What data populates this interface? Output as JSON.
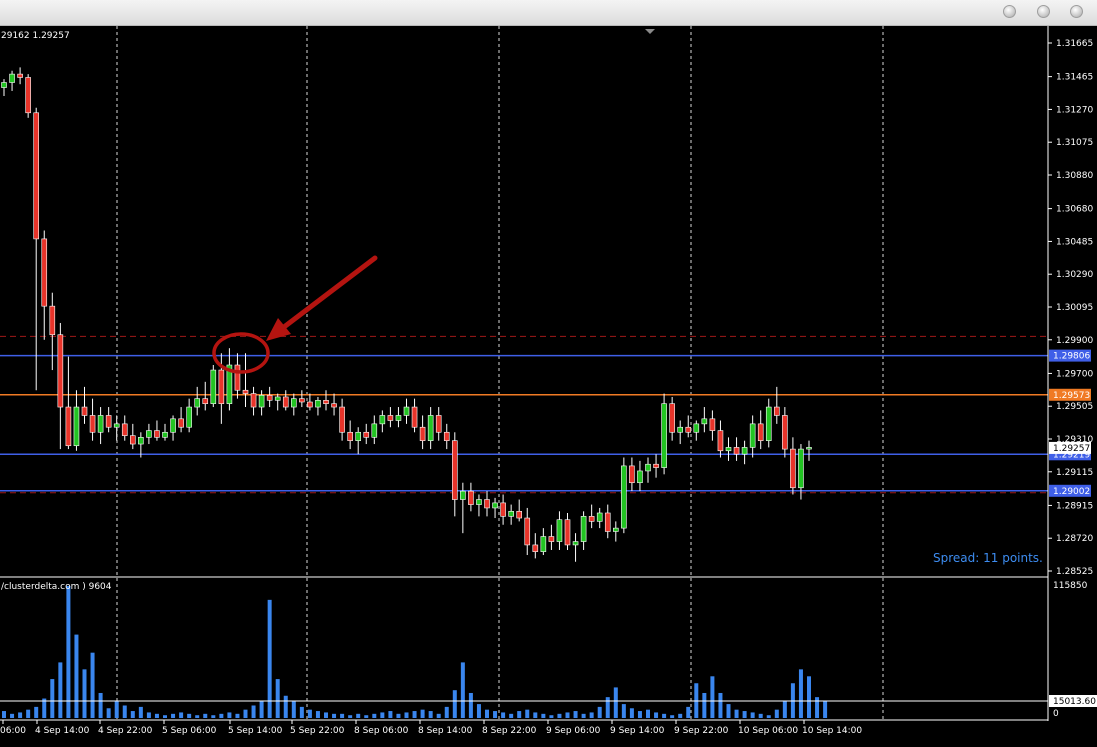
{
  "window": {
    "buttons": [
      "minimize-button",
      "maximize-button",
      "close-button"
    ]
  },
  "header": {
    "ohlc_text": "29162 1.29257"
  },
  "price_axis": {
    "labels": [
      "1.31665",
      "1.31465",
      "1.31270",
      "1.31075",
      "1.30880",
      "1.30680",
      "1.30485",
      "1.30290",
      "1.30095",
      "1.29900",
      "1.29700",
      "1.29505",
      "1.29310",
      "1.29115",
      "1.28915",
      "1.28720",
      "1.28525"
    ]
  },
  "levels": {
    "blue_upper": "1.29806",
    "orange": "1.29573",
    "current_price": "1.29257",
    "blue_mid": "1.29219",
    "blue_lower": "1.29002"
  },
  "spread_text": "Spread: 11 points.",
  "indicator": {
    "label": "/clusterdelta.com ) 9604",
    "axis_top": "115850",
    "axis_level": "15013.60",
    "axis_zero": "0"
  },
  "time_axis": {
    "labels": [
      "06:00",
      "4 Sep 14:00",
      "4 Sep 22:00",
      "5 Sep 06:00",
      "5 Sep 14:00",
      "5 Sep 22:00",
      "8 Sep 06:00",
      "8 Sep 14:00",
      "8 Sep 22:00",
      "9 Sep 06:00",
      "9 Sep 14:00",
      "9 Sep 22:00",
      "10 Sep 06:00",
      "10 Sep 14:00"
    ]
  },
  "colors": {
    "background": "#000000",
    "bull": "#22c422",
    "bear": "#e8342a",
    "support_line": "#3f5fe8",
    "orange_line": "#f07a24",
    "dashed_red": "#a01818",
    "volume": "#3a86ee",
    "annotation": "#b41410",
    "grid": "#ffffff"
  },
  "candles": [
    {
      "o": 1.314,
      "h": 1.3145,
      "l": 1.3135,
      "c": 1.3143
    },
    {
      "o": 1.3143,
      "h": 1.315,
      "l": 1.3138,
      "c": 1.3148
    },
    {
      "o": 1.3148,
      "h": 1.3152,
      "l": 1.3142,
      "c": 1.3146
    },
    {
      "o": 1.3146,
      "h": 1.3148,
      "l": 1.3122,
      "c": 1.3125
    },
    {
      "o": 1.3125,
      "h": 1.3128,
      "l": 1.296,
      "c": 1.305
    },
    {
      "o": 1.305,
      "h": 1.3055,
      "l": 1.299,
      "c": 1.301
    },
    {
      "o": 1.301,
      "h": 1.3018,
      "l": 1.2972,
      "c": 1.2993
    },
    {
      "o": 1.2993,
      "h": 1.3,
      "l": 1.2925,
      "c": 1.295
    },
    {
      "o": 1.295,
      "h": 1.298,
      "l": 1.2925,
      "c": 1.2927
    },
    {
      "o": 1.2927,
      "h": 1.296,
      "l": 1.2924,
      "c": 1.295
    },
    {
      "o": 1.295,
      "h": 1.2962,
      "l": 1.294,
      "c": 1.2945
    },
    {
      "o": 1.2945,
      "h": 1.2955,
      "l": 1.293,
      "c": 1.2935
    },
    {
      "o": 1.2935,
      "h": 1.295,
      "l": 1.2928,
      "c": 1.2945
    },
    {
      "o": 1.2945,
      "h": 1.295,
      "l": 1.2935,
      "c": 1.2938
    },
    {
      "o": 1.2938,
      "h": 1.2945,
      "l": 1.293,
      "c": 1.294
    },
    {
      "o": 1.294,
      "h": 1.2945,
      "l": 1.293,
      "c": 1.2933
    },
    {
      "o": 1.2933,
      "h": 1.294,
      "l": 1.2925,
      "c": 1.2928
    },
    {
      "o": 1.2928,
      "h": 1.2935,
      "l": 1.292,
      "c": 1.2932
    },
    {
      "o": 1.2932,
      "h": 1.294,
      "l": 1.2928,
      "c": 1.2936
    },
    {
      "o": 1.2936,
      "h": 1.2942,
      "l": 1.293,
      "c": 1.2932
    },
    {
      "o": 1.2932,
      "h": 1.294,
      "l": 1.293,
      "c": 1.2935
    },
    {
      "o": 1.2935,
      "h": 1.2945,
      "l": 1.293,
      "c": 1.2943
    },
    {
      "o": 1.2943,
      "h": 1.295,
      "l": 1.2935,
      "c": 1.2938
    },
    {
      "o": 1.2938,
      "h": 1.2955,
      "l": 1.2935,
      "c": 1.295
    },
    {
      "o": 1.295,
      "h": 1.2962,
      "l": 1.2945,
      "c": 1.2955
    },
    {
      "o": 1.2955,
      "h": 1.2965,
      "l": 1.2948,
      "c": 1.2952
    },
    {
      "o": 1.2952,
      "h": 1.2975,
      "l": 1.295,
      "c": 1.2972
    },
    {
      "o": 1.2972,
      "h": 1.2982,
      "l": 1.294,
      "c": 1.2952
    },
    {
      "o": 1.2952,
      "h": 1.2985,
      "l": 1.2948,
      "c": 1.2975
    },
    {
      "o": 1.2975,
      "h": 1.2982,
      "l": 1.2955,
      "c": 1.296
    },
    {
      "o": 1.296,
      "h": 1.2982,
      "l": 1.295,
      "c": 1.2958
    },
    {
      "o": 1.2958,
      "h": 1.2962,
      "l": 1.2945,
      "c": 1.295
    },
    {
      "o": 1.295,
      "h": 1.296,
      "l": 1.2945,
      "c": 1.2957
    },
    {
      "o": 1.2957,
      "h": 1.2962,
      "l": 1.295,
      "c": 1.2954
    },
    {
      "o": 1.2954,
      "h": 1.2958,
      "l": 1.2948,
      "c": 1.2956
    },
    {
      "o": 1.2956,
      "h": 1.296,
      "l": 1.2948,
      "c": 1.295
    },
    {
      "o": 1.295,
      "h": 1.2958,
      "l": 1.2945,
      "c": 1.2955
    },
    {
      "o": 1.2955,
      "h": 1.296,
      "l": 1.295,
      "c": 1.2953
    },
    {
      "o": 1.2953,
      "h": 1.2958,
      "l": 1.2948,
      "c": 1.295
    },
    {
      "o": 1.295,
      "h": 1.2956,
      "l": 1.2945,
      "c": 1.2954
    },
    {
      "o": 1.2954,
      "h": 1.296,
      "l": 1.2948,
      "c": 1.2952
    },
    {
      "o": 1.2952,
      "h": 1.2958,
      "l": 1.2945,
      "c": 1.295
    },
    {
      "o": 1.295,
      "h": 1.2955,
      "l": 1.293,
      "c": 1.2935
    },
    {
      "o": 1.2935,
      "h": 1.2942,
      "l": 1.2925,
      "c": 1.293
    },
    {
      "o": 1.293,
      "h": 1.2938,
      "l": 1.2922,
      "c": 1.2935
    },
    {
      "o": 1.2935,
      "h": 1.294,
      "l": 1.2928,
      "c": 1.2932
    },
    {
      "o": 1.2932,
      "h": 1.2945,
      "l": 1.2928,
      "c": 1.294
    },
    {
      "o": 1.294,
      "h": 1.2948,
      "l": 1.2935,
      "c": 1.2945
    },
    {
      "o": 1.2945,
      "h": 1.295,
      "l": 1.2938,
      "c": 1.2942
    },
    {
      "o": 1.2942,
      "h": 1.295,
      "l": 1.2938,
      "c": 1.2945
    },
    {
      "o": 1.2945,
      "h": 1.2955,
      "l": 1.294,
      "c": 1.295
    },
    {
      "o": 1.295,
      "h": 1.2955,
      "l": 1.2935,
      "c": 1.2938
    },
    {
      "o": 1.2938,
      "h": 1.2945,
      "l": 1.2925,
      "c": 1.293
    },
    {
      "o": 1.293,
      "h": 1.295,
      "l": 1.2925,
      "c": 1.2945
    },
    {
      "o": 1.2945,
      "h": 1.295,
      "l": 1.293,
      "c": 1.2935
    },
    {
      "o": 1.2935,
      "h": 1.294,
      "l": 1.2925,
      "c": 1.293
    },
    {
      "o": 1.293,
      "h": 1.2935,
      "l": 1.2885,
      "c": 1.2895
    },
    {
      "o": 1.2895,
      "h": 1.2905,
      "l": 1.2875,
      "c": 1.29
    },
    {
      "o": 1.29,
      "h": 1.2905,
      "l": 1.2888,
      "c": 1.2892
    },
    {
      "o": 1.2892,
      "h": 1.2898,
      "l": 1.2885,
      "c": 1.2895
    },
    {
      "o": 1.2895,
      "h": 1.29,
      "l": 1.2885,
      "c": 1.289
    },
    {
      "o": 1.289,
      "h": 1.2896,
      "l": 1.2884,
      "c": 1.2893
    },
    {
      "o": 1.2893,
      "h": 1.2898,
      "l": 1.288,
      "c": 1.2885
    },
    {
      "o": 1.2885,
      "h": 1.2892,
      "l": 1.288,
      "c": 1.2888
    },
    {
      "o": 1.2888,
      "h": 1.2895,
      "l": 1.2882,
      "c": 1.2884
    },
    {
      "o": 1.2884,
      "h": 1.289,
      "l": 1.2862,
      "c": 1.2868
    },
    {
      "o": 1.2868,
      "h": 1.2875,
      "l": 1.286,
      "c": 1.2864
    },
    {
      "o": 1.2864,
      "h": 1.2878,
      "l": 1.2862,
      "c": 1.2873
    },
    {
      "o": 1.2873,
      "h": 1.288,
      "l": 1.2865,
      "c": 1.287
    },
    {
      "o": 1.287,
      "h": 1.2888,
      "l": 1.2865,
      "c": 1.2883
    },
    {
      "o": 1.2883,
      "h": 1.2887,
      "l": 1.2865,
      "c": 1.2868
    },
    {
      "o": 1.2868,
      "h": 1.2875,
      "l": 1.2858,
      "c": 1.287
    },
    {
      "o": 1.287,
      "h": 1.2888,
      "l": 1.2865,
      "c": 1.2885
    },
    {
      "o": 1.2885,
      "h": 1.2892,
      "l": 1.2878,
      "c": 1.2882
    },
    {
      "o": 1.2882,
      "h": 1.289,
      "l": 1.2878,
      "c": 1.2887
    },
    {
      "o": 1.2887,
      "h": 1.2892,
      "l": 1.2872,
      "c": 1.2876
    },
    {
      "o": 1.2876,
      "h": 1.2882,
      "l": 1.287,
      "c": 1.2878
    },
    {
      "o": 1.2878,
      "h": 1.292,
      "l": 1.2875,
      "c": 1.2915
    },
    {
      "o": 1.2915,
      "h": 1.292,
      "l": 1.29,
      "c": 1.2905
    },
    {
      "o": 1.2905,
      "h": 1.2918,
      "l": 1.29,
      "c": 1.2912
    },
    {
      "o": 1.2912,
      "h": 1.292,
      "l": 1.2905,
      "c": 1.2916
    },
    {
      "o": 1.2916,
      "h": 1.2922,
      "l": 1.2908,
      "c": 1.2914
    },
    {
      "o": 1.2914,
      "h": 1.2958,
      "l": 1.291,
      "c": 1.2952
    },
    {
      "o": 1.2952,
      "h": 1.2956,
      "l": 1.293,
      "c": 1.2935
    },
    {
      "o": 1.2935,
      "h": 1.2942,
      "l": 1.2928,
      "c": 1.2938
    },
    {
      "o": 1.2938,
      "h": 1.2945,
      "l": 1.2932,
      "c": 1.2935
    },
    {
      "o": 1.2935,
      "h": 1.2942,
      "l": 1.293,
      "c": 1.294
    },
    {
      "o": 1.294,
      "h": 1.295,
      "l": 1.2935,
      "c": 1.2943
    },
    {
      "o": 1.2943,
      "h": 1.2948,
      "l": 1.293,
      "c": 1.2936
    },
    {
      "o": 1.2936,
      "h": 1.2942,
      "l": 1.292,
      "c": 1.2924
    },
    {
      "o": 1.2924,
      "h": 1.2932,
      "l": 1.2918,
      "c": 1.2926
    },
    {
      "o": 1.2926,
      "h": 1.2932,
      "l": 1.2918,
      "c": 1.2922
    },
    {
      "o": 1.2922,
      "h": 1.293,
      "l": 1.2916,
      "c": 1.2926
    },
    {
      "o": 1.2926,
      "h": 1.2945,
      "l": 1.292,
      "c": 1.294
    },
    {
      "o": 1.294,
      "h": 1.2948,
      "l": 1.2925,
      "c": 1.293
    },
    {
      "o": 1.293,
      "h": 1.2955,
      "l": 1.2926,
      "c": 1.295
    },
    {
      "o": 1.295,
      "h": 1.2962,
      "l": 1.294,
      "c": 1.2945
    },
    {
      "o": 1.2945,
      "h": 1.295,
      "l": 1.292,
      "c": 1.2925
    },
    {
      "o": 1.2925,
      "h": 1.2932,
      "l": 1.2898,
      "c": 1.2902
    },
    {
      "o": 1.2902,
      "h": 1.2928,
      "l": 1.2895,
      "c": 1.2925
    },
    {
      "o": 1.2925,
      "h": 1.293,
      "l": 1.2918,
      "c": 1.2926
    }
  ],
  "volumes": [
    5,
    3,
    4,
    6,
    8,
    14,
    28,
    40,
    95,
    60,
    35,
    47,
    18,
    7,
    12,
    9,
    5,
    8,
    4,
    3,
    2,
    3,
    4,
    3,
    2,
    3,
    2,
    3,
    4,
    3,
    6,
    9,
    12,
    85,
    28,
    16,
    12,
    8,
    6,
    5,
    4,
    3,
    3,
    2,
    3,
    2,
    3,
    4,
    5,
    3,
    4,
    5,
    6,
    5,
    3,
    8,
    20,
    40,
    18,
    10,
    6,
    5,
    4,
    3,
    5,
    6,
    4,
    3,
    2,
    3,
    4,
    5,
    3,
    4,
    8,
    15,
    22,
    10,
    7,
    5,
    6,
    4,
    3,
    2,
    3,
    8,
    25,
    18,
    30,
    18,
    10,
    6,
    5,
    4,
    3,
    2,
    6,
    12,
    25,
    35,
    30,
    15,
    12
  ]
}
